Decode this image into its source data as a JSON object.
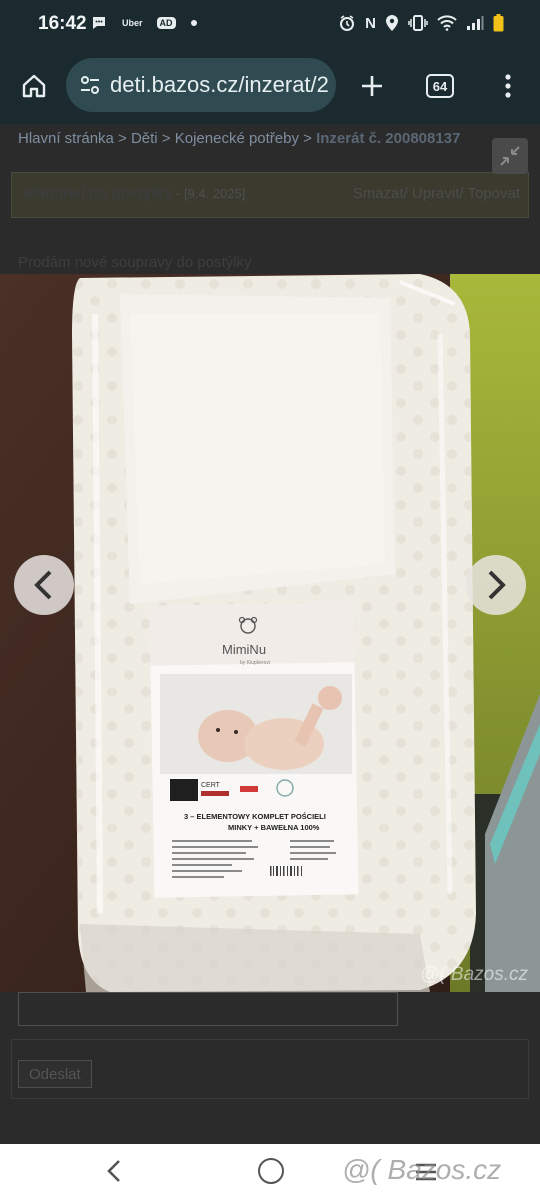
{
  "status_bar": {
    "time": "16:42",
    "left_icons": [
      "chat-bubble-icon",
      "uber-icon",
      "ad-badge-icon",
      "dot-icon"
    ],
    "uber_label": "Uber",
    "ad_label": "AD",
    "right_icons": [
      "alarm-icon",
      "nfc-icon",
      "location-icon",
      "vibrate-icon",
      "wifi-icon",
      "signal-icon",
      "battery-icon"
    ],
    "nfc_label": "N"
  },
  "browser": {
    "url": "deti.bazos.cz/inzerat/2",
    "tab_count": "64"
  },
  "page": {
    "breadcrumb": {
      "prefix": "Hlavní stránka > Děti > Kojenecké potřeby > ",
      "current": "Inzerát č. 200808137"
    },
    "ad_title": "Mantinel do postýlky",
    "ad_date": "- [9.4. 2025]",
    "ad_actions": "Smazat/ Upravit/ Topovat",
    "description": "Prodám nové soupravy do postýlky",
    "send_button": "Odeslat"
  },
  "photo": {
    "brand": "MimiNu",
    "brand_sub": "by Klupšerovi",
    "product_line1": "3 – ELEMENTOWY KOMPLET POŚCIELI",
    "product_line2": "MINKY + BAWEŁNA 100%",
    "cert_label": "CERT",
    "watermark": "@( Bazos.cz"
  },
  "nav_bar": {
    "watermark": "@( Bazos.cz"
  },
  "colors": {
    "status_bar_bg": "#1b2a2e",
    "url_bar_bg": "#2f4b51",
    "dimmed_page_bg": "#2b2b2b",
    "nav_bar_bg": "#ffffff"
  }
}
